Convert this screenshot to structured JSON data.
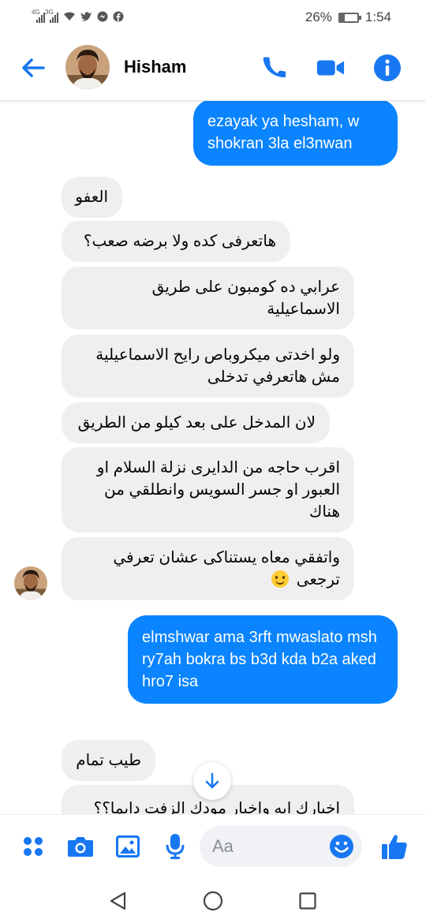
{
  "status_bar": {
    "network_1": "4G",
    "network_2": "3G",
    "battery": "26%",
    "battery_level": 0.26,
    "time": "1:54"
  },
  "header": {
    "contact_name": "Hisham",
    "icons": [
      "back-arrow-icon",
      "avatar",
      "phone-icon",
      "video-call-icon",
      "info-icon"
    ]
  },
  "messages": [
    {
      "side": "sent",
      "text": "ezayak ya hesham, w shokran 3la el3nwan"
    },
    {
      "side": "received",
      "text": "العفو"
    },
    {
      "side": "received",
      "text": "هاتعرفى كده ولا برضه صعب؟"
    },
    {
      "side": "received",
      "text": "عرابي ده كومبون على طريق الاسماعيلية"
    },
    {
      "side": "received",
      "text": "ولو اخدتى ميكروباص رايح الاسماعيلية مش هاتعرفي تدخلى"
    },
    {
      "side": "received",
      "text": "لان المدخل على بعد كيلو من الطريق"
    },
    {
      "side": "received",
      "text": "اقرب حاجه من الدايرى نزلة السلام او العبور او جسر السويس وانطلقي من هناك"
    },
    {
      "side": "received",
      "text": "واتفقي معاه يستناكى عشان تعرفي ترجعى",
      "emoji": "slightly-smiling-face"
    },
    {
      "side": "sent",
      "text": "elmshwar ama 3rft mwaslato msh ry7ah bokra bs b3d kda b2a aked hro7 isa"
    },
    {
      "side": "received",
      "text": "طيب تمام"
    },
    {
      "side": "received",
      "text": "اخبارك ايه واخبار مودك الزفت دايما؟؟"
    }
  ],
  "composer": {
    "placeholder": "Aa",
    "icons": [
      "apps-grid-icon",
      "camera-icon",
      "gallery-icon",
      "microphone-icon",
      "emoji-icon",
      "thumbs-up-icon"
    ]
  },
  "nav": {
    "icons": [
      "back-triangle-icon",
      "home-circle-icon",
      "recents-square-icon"
    ]
  },
  "colors": {
    "accent": "#0a84ff",
    "received_bubble": "#efefef",
    "icon_blue": "#1877f2"
  }
}
